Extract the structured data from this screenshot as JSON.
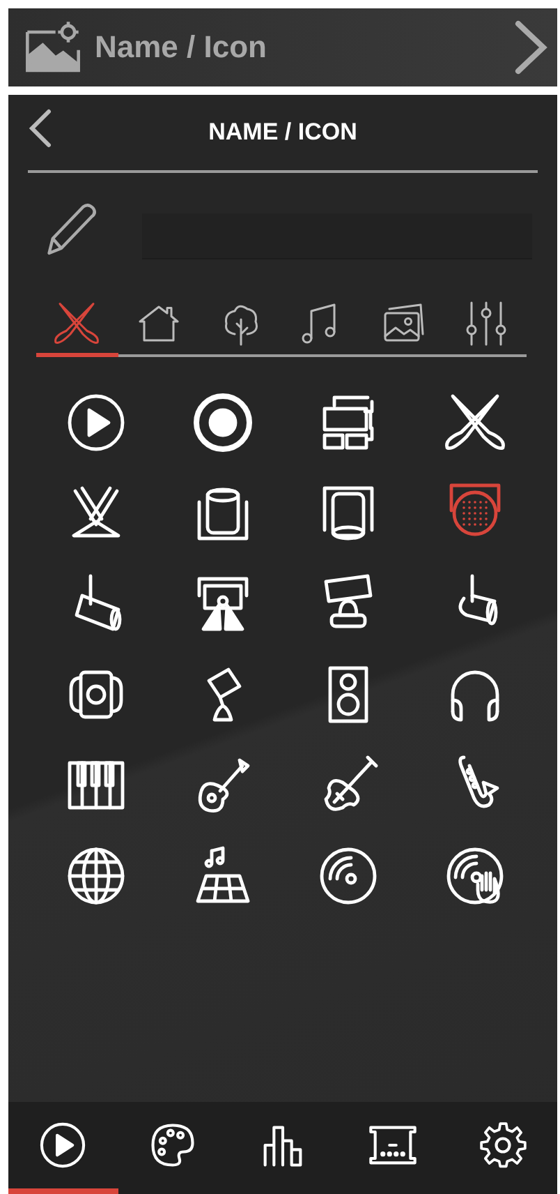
{
  "header": {
    "title": "Name / Icon"
  },
  "panel": {
    "title": "NAME / ICON"
  },
  "categories": [
    {
      "kind": "lights",
      "selected": true
    },
    {
      "kind": "house",
      "selected": false
    },
    {
      "kind": "tree",
      "selected": false
    },
    {
      "kind": "music",
      "selected": false
    },
    {
      "kind": "pictures",
      "selected": false
    },
    {
      "kind": "sliders",
      "selected": false
    }
  ],
  "icons": [
    {
      "kind": "play",
      "selected": false
    },
    {
      "kind": "record",
      "selected": false
    },
    {
      "kind": "layout",
      "selected": false
    },
    {
      "kind": "crossed",
      "selected": false
    },
    {
      "kind": "stagespots",
      "selected": false
    },
    {
      "kind": "cylinder",
      "selected": false
    },
    {
      "kind": "cylinderdown",
      "selected": false
    },
    {
      "kind": "gridlight",
      "selected": true
    },
    {
      "kind": "spot",
      "selected": false
    },
    {
      "kind": "projector",
      "selected": false
    },
    {
      "kind": "movinghead",
      "selected": false
    },
    {
      "kind": "parcan",
      "selected": false
    },
    {
      "kind": "fresnel",
      "selected": false
    },
    {
      "kind": "tiltspot",
      "selected": false
    },
    {
      "kind": "speaker",
      "selected": false
    },
    {
      "kind": "headphones",
      "selected": false
    },
    {
      "kind": "piano",
      "selected": false
    },
    {
      "kind": "guitar",
      "selected": false
    },
    {
      "kind": "violin",
      "selected": false
    },
    {
      "kind": "saxophone",
      "selected": false
    },
    {
      "kind": "globe",
      "selected": false
    },
    {
      "kind": "dancefloor",
      "selected": false
    },
    {
      "kind": "disc",
      "selected": false
    },
    {
      "kind": "dischand",
      "selected": false
    }
  ],
  "nav": [
    {
      "kind": "play",
      "selected": true
    },
    {
      "kind": "palette",
      "selected": false
    },
    {
      "kind": "bars",
      "selected": false
    },
    {
      "kind": "stage",
      "selected": false
    },
    {
      "kind": "gear",
      "selected": false
    }
  ]
}
